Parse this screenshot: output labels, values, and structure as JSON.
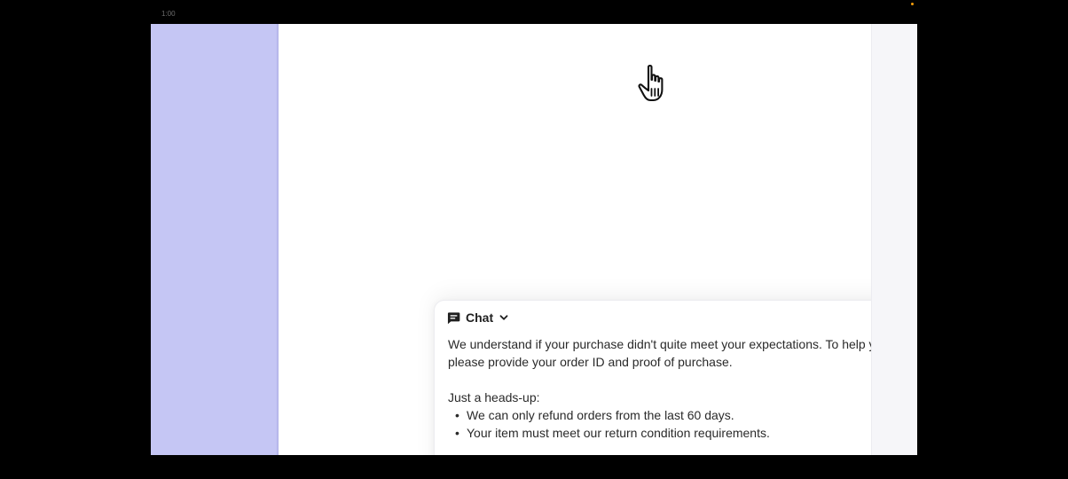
{
  "recording": {
    "timestamp": "1:00",
    "indicator_color": "#f59e0b"
  },
  "colors": {
    "left_panel": "#c5c6f4",
    "main_panel": "#ffffff",
    "background": "#000000"
  },
  "cursor": {
    "icon": "hand-pointer-icon"
  },
  "chat": {
    "header_icon": "chat-bubble-icon",
    "header_label": "Chat",
    "dropdown_icon": "chevron-down-icon",
    "message_paragraph": "We understand if your purchase didn't quite meet your expectations. To help you with a refund, please provide your order ID and proof of purchase.",
    "headsup_label": "Just a heads-up:",
    "bullets": [
      "We can only refund orders from the last 60 days.",
      "Your item must meet our return condition requirements."
    ],
    "bullet_glyph": "•"
  }
}
